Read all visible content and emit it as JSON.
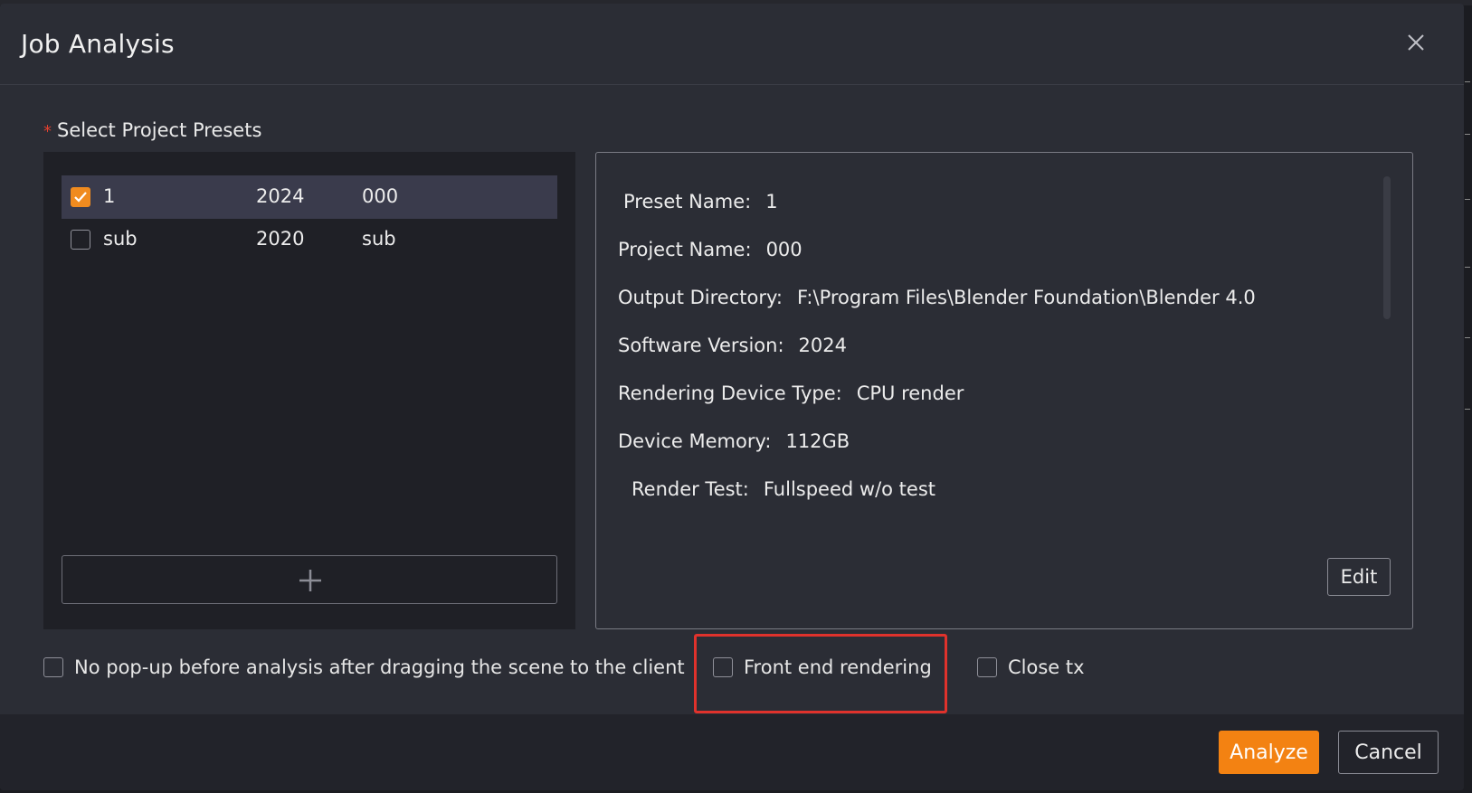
{
  "dialog": {
    "title": "Job Analysis",
    "close_icon": "close-icon"
  },
  "presets": {
    "label": "Select Project Presets",
    "required_marker": "*",
    "rows": [
      {
        "checked": true,
        "name": "1",
        "version": "2024",
        "project": "000"
      },
      {
        "checked": false,
        "name": "sub",
        "version": "2020",
        "project": "sub"
      }
    ],
    "add_icon": "plus-icon"
  },
  "details": {
    "preset_name_label": "Preset Name:",
    "preset_name_value": "1",
    "project_name_label": "Project Name:",
    "project_name_value": "000",
    "output_dir_label": "Output Directory:",
    "output_dir_value": "F:\\Program Files\\Blender Foundation\\Blender 4.0",
    "software_version_label": "Software Version:",
    "software_version_value": "2024",
    "device_type_label": "Rendering Device Type:",
    "device_type_value": "CPU render",
    "device_memory_label": "Device Memory:",
    "device_memory_value": "112GB",
    "render_test_label": "Render Test:",
    "render_test_value": "Fullspeed w/o test",
    "edit_label": "Edit"
  },
  "options": {
    "no_popup_label": "No pop-up before analysis after dragging the scene to the client",
    "no_popup_checked": false,
    "front_end_label": "Front end rendering",
    "front_end_checked": false,
    "close_tx_label": "Close tx",
    "close_tx_checked": false
  },
  "footer": {
    "analyze_label": "Analyze",
    "cancel_label": "Cancel"
  },
  "colors": {
    "accent": "#f38212",
    "highlight": "#e0322c"
  }
}
